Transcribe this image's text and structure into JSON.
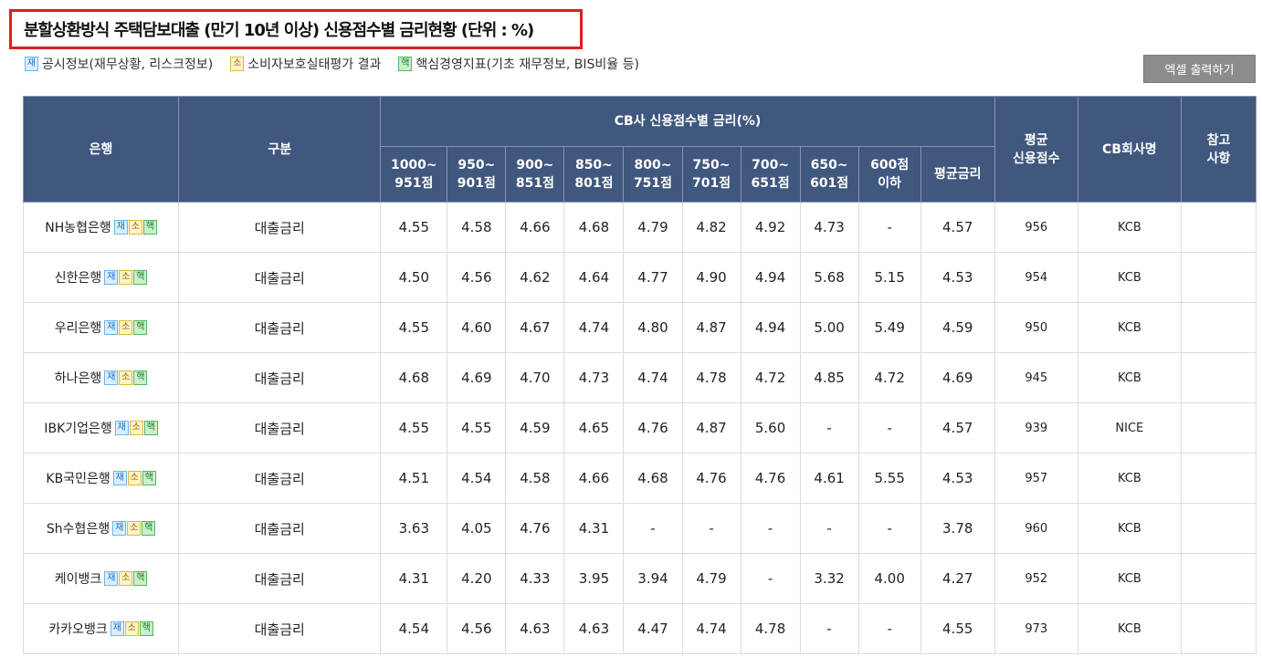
{
  "title": "분할상환방식 주택담보대출 (만기 10년 이상) 신용점수별 금리현황 (단위 : %)",
  "legend": [
    {
      "badge": "재",
      "text": "공시정보(재무상황, 리스크정보)"
    },
    {
      "badge": "소",
      "text": "소비자보호실태평가 결과"
    },
    {
      "badge": "핵",
      "text": "핵심경영지표(기초 재무정보, BIS비율 등)"
    }
  ],
  "excel_button": "엑셀 출력하기",
  "headers": {
    "bank": "은행",
    "type": "구분",
    "group": "CB사 신용점수별 금리(%)",
    "score_cols": [
      "1000~\n951점",
      "950~\n901점",
      "900~\n851점",
      "850~\n801점",
      "800~\n751점",
      "750~\n701점",
      "700~\n651점",
      "650~\n601점",
      "600점\n이하"
    ],
    "avg_rate": "평균금리",
    "avg_score": "평균\n신용점수",
    "cb_name": "CB회사명",
    "note": "참고\n사항"
  },
  "badges": {
    "jae": "재",
    "so": "소",
    "hae": "핵"
  },
  "rows": [
    {
      "bank": "NH농협은행",
      "type": "대출금리",
      "rates": [
        "4.55",
        "4.58",
        "4.66",
        "4.68",
        "4.79",
        "4.82",
        "4.92",
        "4.73",
        "-"
      ],
      "avg": "4.57",
      "score": "956",
      "cb": "KCB",
      "note": ""
    },
    {
      "bank": "신한은행",
      "type": "대출금리",
      "rates": [
        "4.50",
        "4.56",
        "4.62",
        "4.64",
        "4.77",
        "4.90",
        "4.94",
        "5.68",
        "5.15"
      ],
      "avg": "4.53",
      "score": "954",
      "cb": "KCB",
      "note": ""
    },
    {
      "bank": "우리은행",
      "type": "대출금리",
      "rates": [
        "4.55",
        "4.60",
        "4.67",
        "4.74",
        "4.80",
        "4.87",
        "4.94",
        "5.00",
        "5.49"
      ],
      "avg": "4.59",
      "score": "950",
      "cb": "KCB",
      "note": ""
    },
    {
      "bank": "하나은행",
      "type": "대출금리",
      "rates": [
        "4.68",
        "4.69",
        "4.70",
        "4.73",
        "4.74",
        "4.78",
        "4.72",
        "4.85",
        "4.72"
      ],
      "avg": "4.69",
      "score": "945",
      "cb": "KCB",
      "note": ""
    },
    {
      "bank": "IBK기업은행",
      "type": "대출금리",
      "rates": [
        "4.55",
        "4.55",
        "4.59",
        "4.65",
        "4.76",
        "4.87",
        "5.60",
        "-",
        "-"
      ],
      "avg": "4.57",
      "score": "939",
      "cb": "NICE",
      "note": ""
    },
    {
      "bank": "KB국민은행",
      "type": "대출금리",
      "rates": [
        "4.51",
        "4.54",
        "4.58",
        "4.66",
        "4.68",
        "4.76",
        "4.76",
        "4.61",
        "5.55"
      ],
      "avg": "4.53",
      "score": "957",
      "cb": "KCB",
      "note": ""
    },
    {
      "bank": "Sh수협은행",
      "type": "대출금리",
      "rates": [
        "3.63",
        "4.05",
        "4.76",
        "4.31",
        "-",
        "-",
        "-",
        "-",
        "-"
      ],
      "avg": "3.78",
      "score": "960",
      "cb": "KCB",
      "note": ""
    },
    {
      "bank": "케이뱅크",
      "type": "대출금리",
      "rates": [
        "4.31",
        "4.20",
        "4.33",
        "3.95",
        "3.94",
        "4.79",
        "-",
        "3.32",
        "4.00"
      ],
      "avg": "4.27",
      "score": "952",
      "cb": "KCB",
      "note": ""
    },
    {
      "bank": "카카오뱅크",
      "type": "대출금리",
      "rates": [
        "4.54",
        "4.56",
        "4.63",
        "4.63",
        "4.47",
        "4.74",
        "4.78",
        "-",
        "-"
      ],
      "avg": "4.55",
      "score": "973",
      "cb": "KCB",
      "note": ""
    }
  ]
}
